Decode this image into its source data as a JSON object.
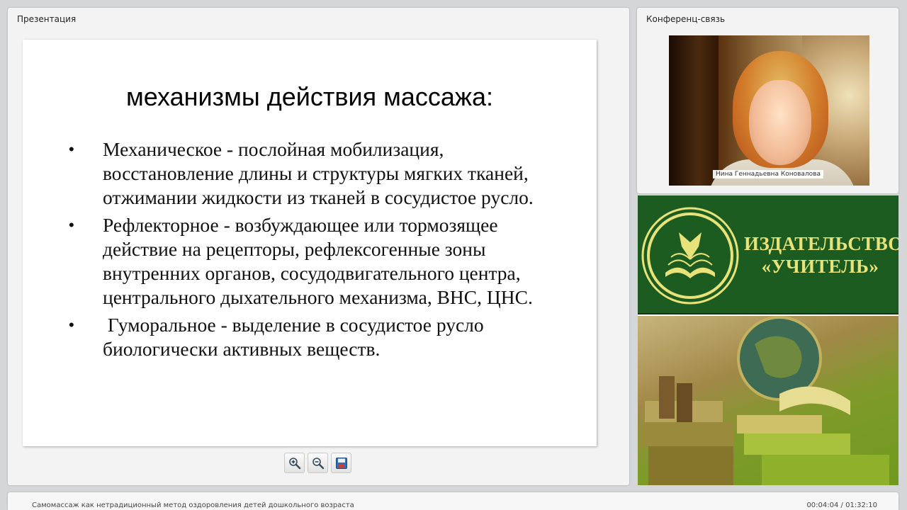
{
  "presentation_panel": {
    "title": "Презентация"
  },
  "slide": {
    "title": "механизмы действия массажа:",
    "bullets": [
      {
        "marker": "•",
        "text": "Механическое - послойная мобилизация, восстановление длины и структуры мягких тканей, отжимании жидкости из тканей в сосудистое русло."
      },
      {
        "marker": "•",
        "text": "Рефлекторное - возбуждающее или тормозящее действие на рецепторы, рефлексогенные зоны внутренних органов, сосудодвигательного центра, центрального дыхательного механизма, ВНС, ЦНС."
      },
      {
        "marker": "•",
        "text": " Гуморальное - выделение в сосудистое русло биологически активных веществ."
      }
    ]
  },
  "toolbar": {
    "zoom_in_icon": "zoom-in-icon",
    "zoom_out_icon": "zoom-out-icon",
    "save_icon": "floppy-disk-icon"
  },
  "conference_panel": {
    "title": "Конференц-связь",
    "speaker_name": "Нина Геннадьевна Коновалова"
  },
  "ad": {
    "brand_line1": "ИЗДАТЕЛЬСТВО",
    "brand_line2": "«УЧИТЕЛЬ»",
    "colors": {
      "background": "#1d5c20",
      "text": "#e7e27a"
    }
  },
  "footer": {
    "title": "Самомассаж как нетрадиционный метод оздоровления детей дошкольного возраста",
    "time": "00:04:04 / 01:32:10"
  }
}
